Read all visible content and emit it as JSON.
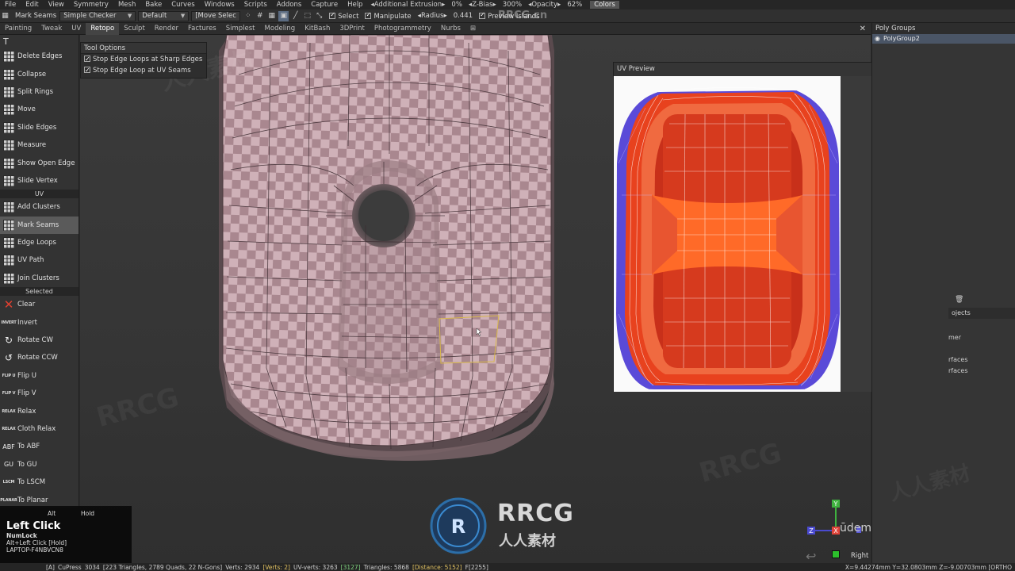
{
  "menu": {
    "items": [
      "File",
      "Edit",
      "View",
      "Symmetry",
      "Mesh",
      "Bake",
      "Curves",
      "Windows",
      "Scripts",
      "Addons",
      "Capture",
      "Help"
    ],
    "additional_extrusion_label": "Additional Extrusion",
    "additional_extrusion_value": "0%",
    "zbias_label": "Z-Bias",
    "zbias_value": "300%",
    "opacity_label": "Opacity",
    "opacity_value": "62%",
    "colors_label": "Colors"
  },
  "toolbar": {
    "tool_name": "Mark Seams",
    "material": "Simple Checker",
    "shader": "Default",
    "move_select": "[Move Selec",
    "select_label": "Select",
    "manipulate_label": "Manipulate",
    "radius_label": "Radius",
    "radius_value": "0.441",
    "preview_islands_label": "Preview Islands"
  },
  "tabs": [
    "Painting",
    "Tweak",
    "UV",
    "Retopo",
    "Sculpt",
    "Render",
    "Factures",
    "Simplest",
    "Modeling",
    "KitBash",
    "3DPrint",
    "Photogrammetry",
    "Nurbs"
  ],
  "active_tab": "Retopo",
  "left_tools": {
    "group1": [
      {
        "label": "Delete Edges",
        "icon": "grid-icon"
      },
      {
        "label": "Collapse",
        "icon": "grid-icon"
      },
      {
        "label": "Split Rings",
        "icon": "grid-icon"
      },
      {
        "label": "Move",
        "icon": "grid-icon"
      },
      {
        "label": "Slide Edges",
        "icon": "grid-icon"
      },
      {
        "label": "Measure",
        "icon": "grid-icon"
      },
      {
        "label": "Show Open Edge",
        "icon": "grid-icon"
      },
      {
        "label": "Slide Vertex",
        "icon": "grid-icon"
      }
    ],
    "uv_section": "UV",
    "group2": [
      {
        "label": "Add Clusters"
      },
      {
        "label": "Mark Seams"
      },
      {
        "label": "Edge Loops"
      },
      {
        "label": "UV Path"
      },
      {
        "label": "Join Clusters"
      }
    ],
    "selected_section": "Selected",
    "group3": [
      {
        "label": "Clear",
        "icon": "×"
      },
      {
        "label": "Invert",
        "icon": "INVERT"
      },
      {
        "label": "Rotate CW",
        "icon": "↻"
      },
      {
        "label": "Rotate CCW",
        "icon": "↺"
      },
      {
        "label": "Flip U",
        "icon": "FLIP U"
      },
      {
        "label": "Flip V",
        "icon": "FLIP V"
      },
      {
        "label": "Relax",
        "icon": "RELAX"
      },
      {
        "label": "Cloth Relax",
        "icon": "RELAX"
      },
      {
        "label": "To ABF",
        "icon": "ABF"
      },
      {
        "label": "To GU",
        "icon": "GU"
      },
      {
        "label": "To LSCM",
        "icon": "LSCM"
      },
      {
        "label": "To Planar",
        "icon": "PLANAR"
      }
    ]
  },
  "tool_options": {
    "title": "Tool Options",
    "opt1": "Stop Edge Loops at Sharp Edges",
    "opt2": "Stop Edge Loop at UV Seams"
  },
  "uv_preview": {
    "title": "UV Preview"
  },
  "right_panel": {
    "title": "Poly Groups",
    "group": "PolyGroup2",
    "objects_label": "ojects",
    "row1": "mer",
    "row2": "rfaces",
    "row3": "rfaces"
  },
  "key_overlay": {
    "alt": "Alt",
    "hold": "Hold",
    "left_click": "Left Click",
    "numlock": "NumLock",
    "combo": "Alt+Left Click [Hold]",
    "machine": "LAPTOP-F4NBVCN8"
  },
  "status": {
    "prefix": "[A]",
    "cupress": "CuPress",
    "faces": "3034",
    "tris": "[223 Triangles, 2789 Quads, 22 N-Gons]",
    "verts": "Verts: 2934",
    "sel_verts": "[Verts: 2]",
    "uv_verts": "UV-verts: 3263",
    "uv_sel": "[3127]",
    "triangles": "Triangles: 5868",
    "distance": "[Distance: 5152]",
    "f": "F[2255]",
    "coords": "X=9.44274mm  Y=32.0803mm  Z=-9.00703mm  [ORTHO"
  },
  "view_label": "Right",
  "watermarks": {
    "udemy": "ūdemy",
    "rrcg": "RRCG",
    "rrcg_cn": "人人素材",
    "url": "RRCG.cn"
  },
  "colors": {
    "accent_orange": "#f05a28",
    "uv_red": "#d63a1e",
    "uv_blue": "#4a3fd0",
    "active_tab": "#444444"
  }
}
